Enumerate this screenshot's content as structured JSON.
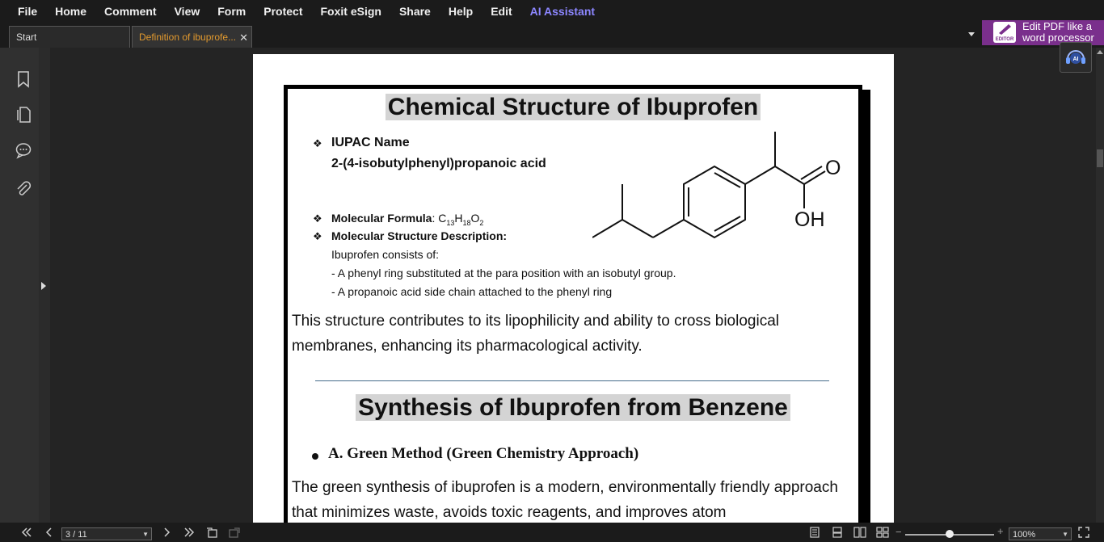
{
  "menu": [
    "File",
    "Home",
    "Comment",
    "View",
    "Form",
    "Protect",
    "Foxit eSign",
    "Share",
    "Help",
    "Edit",
    "AI Assistant"
  ],
  "tabs": {
    "start": "Start",
    "active": "Definition of ibuprofe..."
  },
  "editor_ad": {
    "logo_text": "EDITOR",
    "line1": "Edit PDF like a",
    "line2": "word processor"
  },
  "ai_badge": "AI",
  "document": {
    "title1": "Chemical Structure of Ibuprofen",
    "iupac_label": "IUPAC Name",
    "iupac_value": "2-(4-isobutylphenyl)propanoic acid",
    "formula_label": "Molecular Formula",
    "formula_sep": ":",
    "formula": {
      "C": "C",
      "c_sub": "13",
      "H": "H",
      "h_sub": "18",
      "O": "O",
      "o_sub": "2"
    },
    "structure_label": "Molecular Structure Description:",
    "structure_intro": "Ibuprofen consists of:",
    "structure_line1": "- A phenyl ring substituted at the para position with an isobutyl group.",
    "structure_line2": "- A propanoic acid side chain attached to the phenyl ring",
    "paragraph1": "This structure contributes to its lipophilicity and ability to cross biological membranes, enhancing its pharmacological activity.",
    "title2": "Synthesis of Ibuprofen from Benzene",
    "green_method": "A. Green Method (Green Chemistry Approach)",
    "paragraph2": "The green synthesis of ibuprofen is a modern, environmentally friendly approach that minimizes waste, avoids toxic reagents, and improves atom",
    "molecule_labels": {
      "oxygen": "O",
      "hydroxyl": "OH"
    }
  },
  "status": {
    "page": "3 / 11",
    "zoom": "100%"
  },
  "icons": {
    "bookmark": "bookmark-icon",
    "pages": "pages-icon",
    "comments": "comments-icon",
    "attachment": "attachment-icon",
    "first": "first-page-icon",
    "prev": "prev-page-icon",
    "next": "next-page-icon",
    "last": "last-page-icon"
  },
  "colors": {
    "active_tab": "#e39a2e",
    "ai_assistant": "#8c86ff",
    "editor_ad": "#7a2f8c"
  }
}
